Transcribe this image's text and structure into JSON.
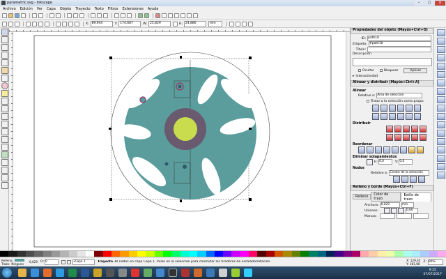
{
  "window": {
    "title": "parametric.svg - Inkscape"
  },
  "menu": [
    "Archivo",
    "Edición",
    "Ver",
    "Capa",
    "Objeto",
    "Trayecto",
    "Texto",
    "Filtros",
    "Extensiones",
    "Ayuda"
  ],
  "toolcontrols": {
    "x_label": "X:",
    "x_value": "89,944",
    "y_label": "Y:",
    "y_value": "174,687",
    "w_label": "W:",
    "w_value": "25,829",
    "h_label": "H:",
    "h_value": "24,886",
    "unit": "mm"
  },
  "object_props": {
    "header": "Propiedades del objeto (Mayús+Ctrl+O)",
    "id_label": "ID:",
    "id_value": "path10",
    "label_label": "Etiqueta:",
    "label_value": "#path10",
    "title_label": "Título:",
    "title_value": "",
    "description_label": "Descripción",
    "hide_label": "Ocultar",
    "lock_label": "Bloquear",
    "apply_label": "Aplicar",
    "interactivity_label": "Interactividad"
  },
  "align": {
    "header": "Alinear y distribuir (Mayús+Ctrl+A)",
    "align_label": "Alinear",
    "relative_label": "Relativo a:",
    "relative_value": "Área de selección",
    "group_label": "Tratar a la selección como grupo:",
    "distribute_label": "Distribuir",
    "rearrange_label": "Reordenar",
    "overlap_label": "Eliminar solapamientos",
    "h_label": "H:",
    "h_value": "0,0",
    "v_label": "V:",
    "v_value": "0,0",
    "nodes_label": "Nodos",
    "nodes_relative_label": "Relativo a:",
    "nodes_relative_value": "Centro de la selección"
  },
  "fill_stroke": {
    "header": "Relleno y borde (Mayús+Ctrl+F)",
    "tabs": [
      "Relleno",
      "Color de trazo",
      "Estilo de trazo"
    ],
    "width_label": "Anchura:",
    "width_value": "0,029",
    "width_unit": "mm",
    "joins_label": "Uniones:",
    "joins_value": "0,00",
    "markers_label": "Marcas:"
  },
  "status": {
    "fill_label": "Relleno:",
    "stroke_label": "Trazo:",
    "stroke_value": "Ninguno",
    "stroke_width": "0,029",
    "opacity_label": "O:",
    "opacity_value": "0",
    "layer": "•Capa 1",
    "message_bold": "Trayecto",
    "message": " 30 nodos en capa Capa 1. Pulse en la selección para conmutar los tiradores de escalado/rotación.",
    "x_coord": "X: 129,35",
    "y_coord": "Y: 181,08",
    "zoom_label": "Z:",
    "zoom_value": "90%"
  },
  "taskbar": {
    "time": "9:25",
    "date": "07/07/2017"
  },
  "colors": {
    "teal": "#5b9c9c",
    "dark_ring": "#6a5a70",
    "yellow": "#c9dc4e",
    "accent_ring": "#8b4a70"
  }
}
